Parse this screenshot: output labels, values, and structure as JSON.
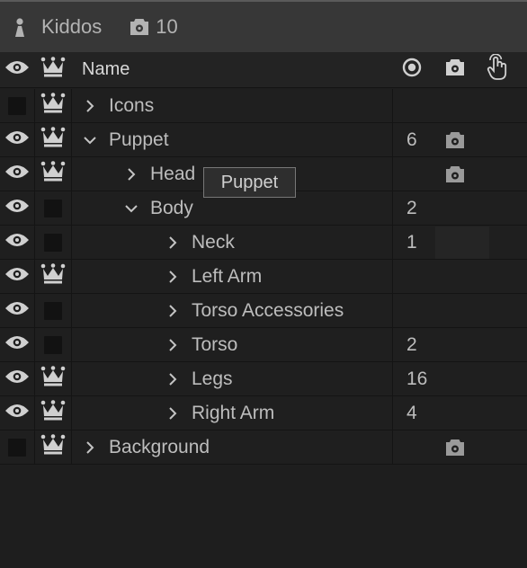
{
  "header": {
    "title": "Kiddos",
    "camera_count": "10"
  },
  "columns": {
    "name": "Name"
  },
  "rows": [
    {
      "name": "Icons",
      "visible": false,
      "crown": true,
      "expanded": false,
      "count": "",
      "camera": false,
      "depth": 0
    },
    {
      "name": "Puppet",
      "visible": true,
      "crown": true,
      "expanded": true,
      "count": "6",
      "camera": true,
      "depth": 0
    },
    {
      "name": "Head",
      "visible": true,
      "crown": true,
      "expanded": false,
      "count": "",
      "camera": true,
      "depth": 1
    },
    {
      "name": "Body",
      "visible": true,
      "crown": false,
      "expanded": true,
      "count": "2",
      "camera": false,
      "depth": 1
    },
    {
      "name": "Neck",
      "visible": true,
      "crown": false,
      "expanded": false,
      "count": "1",
      "camera": false,
      "depth": 2
    },
    {
      "name": "Left Arm",
      "visible": true,
      "crown": true,
      "expanded": false,
      "count": "",
      "camera": false,
      "depth": 2
    },
    {
      "name": "Torso Accessories",
      "visible": true,
      "crown": false,
      "expanded": false,
      "count": "",
      "camera": false,
      "depth": 2
    },
    {
      "name": "Torso",
      "visible": true,
      "crown": false,
      "expanded": false,
      "count": "2",
      "camera": false,
      "depth": 2
    },
    {
      "name": "Legs",
      "visible": true,
      "crown": true,
      "expanded": false,
      "count": "16",
      "camera": false,
      "depth": 2
    },
    {
      "name": "Right Arm",
      "visible": true,
      "crown": true,
      "expanded": false,
      "count": "4",
      "camera": false,
      "depth": 2
    },
    {
      "name": "Background",
      "visible": false,
      "crown": true,
      "expanded": false,
      "count": "",
      "camera": true,
      "depth": 0
    }
  ],
  "tooltip": {
    "text": "Puppet"
  },
  "colors": {
    "background": "#1e1e1e",
    "header": "#373737",
    "row": "#1f1f1f",
    "text": "#bdbdbd",
    "icon": "#d0d0d0",
    "dim_icon": "#9a9a9a"
  }
}
